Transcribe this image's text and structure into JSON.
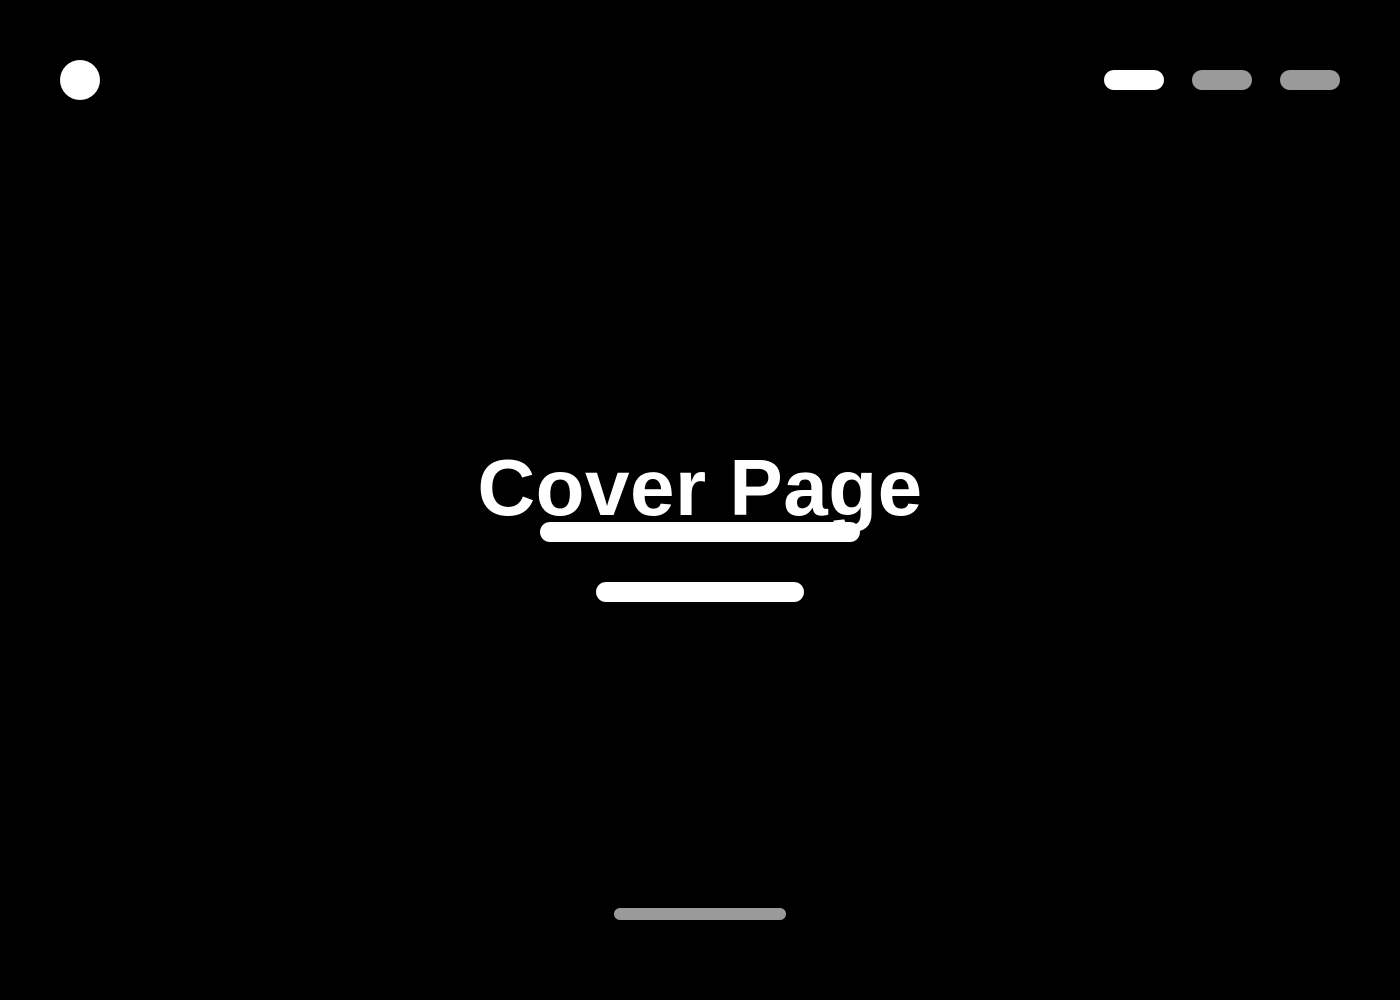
{
  "header": {
    "logo_icon": "circle-logo-icon",
    "nav_items": [
      {
        "name": "nav-pill-1",
        "state": "active"
      },
      {
        "name": "nav-pill-2",
        "state": "inactive"
      },
      {
        "name": "nav-pill-3",
        "state": "inactive"
      }
    ]
  },
  "main": {
    "title": "Cover Page"
  },
  "colors": {
    "background": "#000000",
    "foreground": "#ffffff",
    "muted": "#9a9a9a"
  }
}
